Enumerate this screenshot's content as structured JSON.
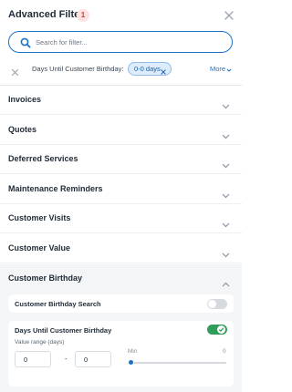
{
  "header": {
    "title": "Advanced Filters",
    "badge_count": "1"
  },
  "search": {
    "placeholder": "Search for filter..."
  },
  "active_filter": {
    "label": "Days Until Customer Birthday:",
    "chip_value": "0-0 days",
    "more_label": "More"
  },
  "sections": [
    {
      "label": "Invoices"
    },
    {
      "label": "Quotes"
    },
    {
      "label": "Deferred Services"
    },
    {
      "label": "Maintenance Reminders"
    },
    {
      "label": "Customer Visits"
    },
    {
      "label": "Customer Value"
    }
  ],
  "birthday": {
    "label": "Customer Birthday",
    "search_card": {
      "title": "Customer Birthday Search",
      "enabled": false
    },
    "days_card": {
      "title": "Days Until Customer Birthday",
      "enabled": true,
      "range_label": "Value range (days)",
      "from_value": "0",
      "separator": "-",
      "to_value": "0",
      "slider_min_label": "Min",
      "slider_max_label": "0",
      "slider_value_fraction": 0
    }
  },
  "colors": {
    "accent": "#1a73c9",
    "badge_bg": "#fde2e2",
    "badge_text": "#d33b3b",
    "toggle_on": "#2f9e59",
    "panel_bg": "#f4f5f7"
  },
  "icons": {
    "close": "close-icon",
    "search": "search-icon",
    "expand": "chevron-down-icon",
    "collapse": "chevron-up-icon",
    "check": "check-icon"
  }
}
